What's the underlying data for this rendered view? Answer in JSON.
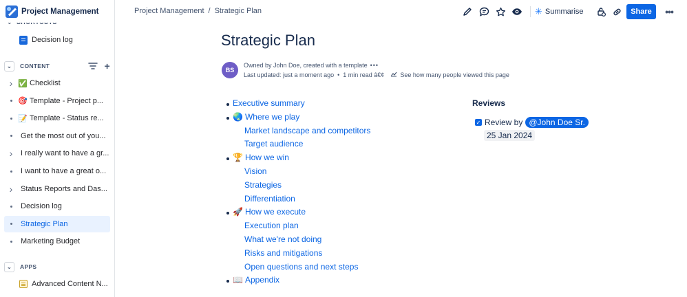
{
  "sidebar": {
    "space_title": "Project Management",
    "shortcuts_label": "SHORTCUTS",
    "shortcut_items": [
      {
        "label": "Decision log",
        "icon": "document-icon"
      }
    ],
    "content_label": "CONTENT",
    "content_items": [
      {
        "label": "Checklist",
        "emoji": "✅",
        "lead": "chevron"
      },
      {
        "label": "Template - Project p...",
        "emoji": "🎯",
        "lead": "dot"
      },
      {
        "label": "Template - Status re...",
        "emoji": "📝",
        "lead": "dot"
      },
      {
        "label": "Get the most out of you...",
        "emoji": "",
        "lead": "dot"
      },
      {
        "label": "I really want to have a gr...",
        "emoji": "",
        "lead": "chevron"
      },
      {
        "label": "I want to have a great o...",
        "emoji": "",
        "lead": "dot"
      },
      {
        "label": "Status Reports and Das...",
        "emoji": "",
        "lead": "chevron"
      },
      {
        "label": "Decision log",
        "emoji": "",
        "lead": "dot"
      },
      {
        "label": "Strategic Plan",
        "emoji": "",
        "lead": "dot",
        "selected": true
      },
      {
        "label": "Marketing Budget",
        "emoji": "",
        "lead": "dot"
      }
    ],
    "apps_label": "APPS",
    "app_items": [
      {
        "label": "Advanced Content N...",
        "icon": "app-icon"
      }
    ]
  },
  "breadcrumb": {
    "space": "Project Management",
    "separator": "/",
    "page": "Strategic Plan"
  },
  "toolbar": {
    "summarise_label": "Summarise",
    "share_label": "Share",
    "icons": [
      "edit-icon",
      "comment-icon",
      "star-icon",
      "watch-icon",
      "restrictions-icon",
      "link-icon",
      "more-icon"
    ]
  },
  "page": {
    "title": "Strategic Plan",
    "avatar_initials": "BS",
    "owner_line": "Owned by John Doe, created with a template",
    "updated": "Last updated: just a moment ago",
    "read_time": "1 min read â€¢",
    "views_link": "See how many people viewed this page"
  },
  "toc": [
    {
      "level": 1,
      "emoji": "",
      "text": "Executive summary"
    },
    {
      "level": 1,
      "emoji": "🌏",
      "text": "Where we play"
    },
    {
      "level": 2,
      "emoji": "",
      "text": "Market landscape and competitors"
    },
    {
      "level": 2,
      "emoji": "",
      "text": "Target audience"
    },
    {
      "level": 1,
      "emoji": "🏆",
      "text": "How we win"
    },
    {
      "level": 2,
      "emoji": "",
      "text": "Vision"
    },
    {
      "level": 2,
      "emoji": "",
      "text": "Strategies"
    },
    {
      "level": 2,
      "emoji": "",
      "text": "Differentiation"
    },
    {
      "level": 1,
      "emoji": "🚀",
      "text": "How we execute"
    },
    {
      "level": 2,
      "emoji": "",
      "text": "Execution plan"
    },
    {
      "level": 2,
      "emoji": "",
      "text": "What we're not doing"
    },
    {
      "level": 2,
      "emoji": "",
      "text": "Risks and mitigations"
    },
    {
      "level": 2,
      "emoji": "",
      "text": "Open questions and next steps"
    },
    {
      "level": 1,
      "emoji": "📖",
      "text": "Appendix"
    }
  ],
  "reviews": {
    "heading": "Reviews",
    "task_text": "Review by",
    "mention": "@John Doe Sr.",
    "date": "25 Jan 2024",
    "checked": true
  }
}
